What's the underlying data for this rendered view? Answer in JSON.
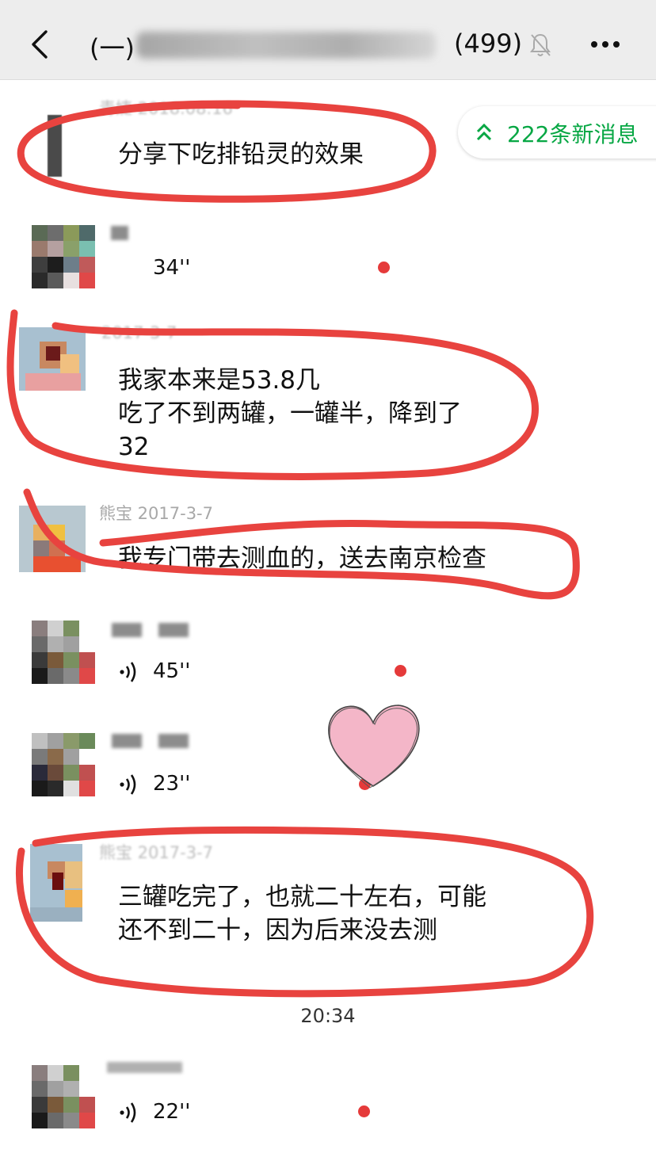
{
  "header": {
    "title_prefix": "(一)",
    "title_count": "(499)"
  },
  "new_messages": {
    "label": "222条新消息"
  },
  "messages": [
    {
      "sender": "青婕 2018.08.16",
      "text": "分享下吃排铅灵的效果"
    },
    {
      "sender": "",
      "voice_duration": "34''"
    },
    {
      "sender": "2017-3-7",
      "lines": [
        "我家本来是53.8几",
        "吃了不到两罐，一罐半，降到了",
        "32"
      ]
    },
    {
      "sender": "熊宝 2017-3-7",
      "text": "我专门带去测血的，送去南京检查"
    },
    {
      "sender": "",
      "voice_duration": "45''"
    },
    {
      "sender": "",
      "voice_duration": "23''"
    },
    {
      "sender": "熊宝 2017-3-7",
      "lines": [
        "三罐吃完了，也就二十左右，可能",
        "还不到二十，因为后来没去测"
      ]
    },
    {
      "sender": "",
      "voice_duration": "22''"
    }
  ],
  "timestamp": "20:34",
  "colors": {
    "header_bg": "#ededed",
    "accent_green": "#07a744",
    "annotation_red": "#e8433f",
    "unread_dot": "#e53a3a",
    "heart_pink": "#f4b6c8"
  },
  "icons": [
    "back-icon",
    "mute-bell-icon",
    "more-icon",
    "double-chevron-up-icon",
    "voice-wave-icon",
    "heart-sticker-icon"
  ]
}
